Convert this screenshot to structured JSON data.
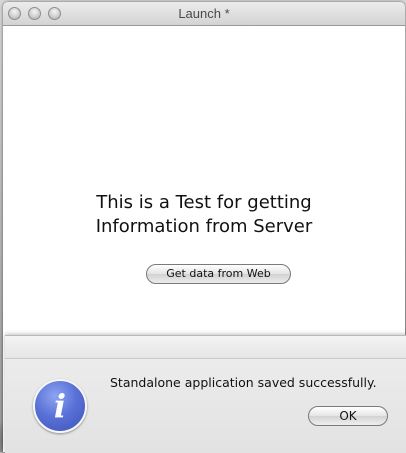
{
  "window": {
    "title": "Launch *"
  },
  "main": {
    "heading_line1": "This is a Test for getting",
    "heading_line2": "Information from Server",
    "web_button_label": "Get data from Web"
  },
  "alert": {
    "icon": "info-icon",
    "icon_glyph": "i",
    "message": "Standalone application saved successfully.",
    "ok_label": "OK"
  }
}
